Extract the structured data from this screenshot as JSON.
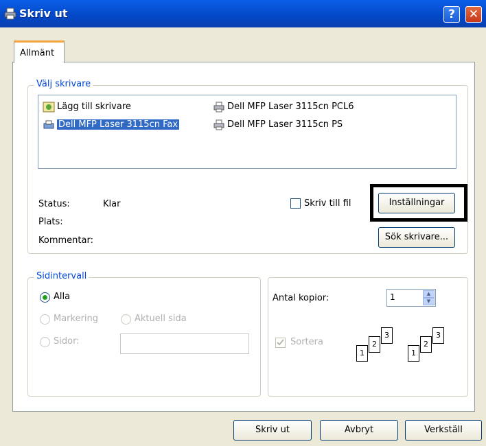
{
  "window": {
    "title": "Skriv ut",
    "help_glyph": "?",
    "close_glyph": "✕"
  },
  "tabs": [
    {
      "label": "Allmänt",
      "active": true
    }
  ],
  "select_printer": {
    "legend": "Välj skrivare",
    "items": [
      {
        "label": "Lägg till skrivare",
        "icon": "add-printer-icon",
        "selected": false
      },
      {
        "label": "Dell MFP Laser 3115cn PCL6",
        "icon": "network-printer-icon",
        "selected": false
      },
      {
        "label": "Dell MFP Laser 3115cn Fax",
        "icon": "fax-printer-icon",
        "selected": true
      },
      {
        "label": "Dell MFP Laser 3115cn PS",
        "icon": "network-printer-icon",
        "selected": false
      }
    ],
    "status_label": "Status:",
    "status_value": "Klar",
    "location_label": "Plats:",
    "comment_label": "Kommentar:",
    "print_to_file_label": "Skriv till fil",
    "print_to_file_checked": false,
    "preferences_button": "Inställningar",
    "find_printer_button": "Sök skrivare..."
  },
  "page_range": {
    "legend": "Sidintervall",
    "all_label": "Alla",
    "selection_label": "Markering",
    "current_page_label": "Aktuell sida",
    "pages_label": "Sidor:",
    "pages_value": "",
    "selected": "all"
  },
  "copies": {
    "number_label": "Antal kopior:",
    "number_value": "1",
    "collate_label": "Sortera",
    "collate_checked": true,
    "page_numbers": [
      "1",
      "2",
      "3"
    ]
  },
  "footer": {
    "print_button": "Skriv ut",
    "cancel_button": "Avbryt",
    "apply_button": "Verkställ"
  },
  "colors": {
    "titlebar": "#0348c9",
    "legend_text": "#0046d5",
    "selection": "#316ac5",
    "tab_accent": "#f3a33c",
    "close_button": "#c7381a"
  }
}
